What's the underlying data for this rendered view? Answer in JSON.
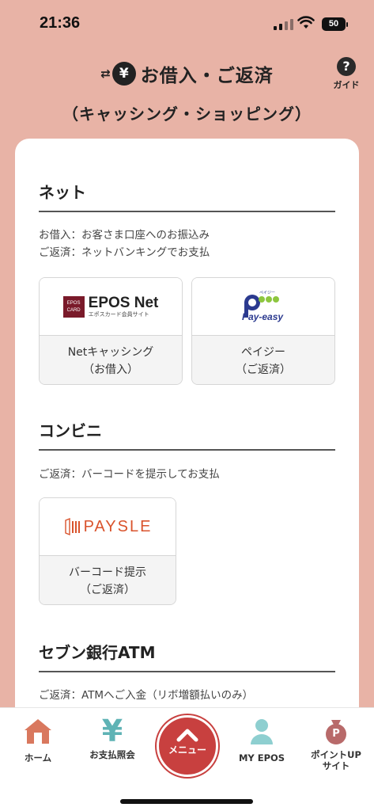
{
  "status_bar": {
    "time": "21:36",
    "battery": "50"
  },
  "header": {
    "title": "お借入・ご返済",
    "subtitle": "（キャッシング・ショッピング）",
    "yen_symbol": "¥",
    "guide_label": "ガイド",
    "guide_icon": "?"
  },
  "sections": {
    "net": {
      "heading": "ネット",
      "desc_line1": "お借入：お客さま口座へのお振込み",
      "desc_line2": "ご返済：ネットバンキングでお支払",
      "tile1": {
        "logo_badge_top": "EPOS",
        "logo_badge_bottom": "CARD",
        "logo_main": "EPOS Net",
        "logo_sub": "エポスカード会員サイト",
        "label_line1": "Netキャッシング",
        "label_line2": "（お借入）"
      },
      "tile2": {
        "logo_small": "ペイジー",
        "logo_main": "Pay-easy",
        "label_line1": "ペイジー",
        "label_line2": "（ご返済）"
      }
    },
    "convenience": {
      "heading": "コンビニ",
      "desc_line1": "ご返済：バーコードを提示してお支払",
      "tile1": {
        "logo_main": "PAYSLE",
        "label_line1": "バーコード提示",
        "label_line2": "（ご返済）"
      }
    },
    "seven": {
      "heading": "セブン銀行ATM",
      "desc_line1": "ご返済：ATMへご入金（リボ増額払いのみ）"
    }
  },
  "bottom_nav": {
    "home": "ホーム",
    "payment_inquiry": "お支払照会",
    "menu": "メニュー",
    "my_epos": "MY EPOS",
    "points_line1": "ポイントUP",
    "points_line2": "サイト",
    "yen_glyph": "¥",
    "points_glyph": "P"
  },
  "colors": {
    "background": "#E8B3A6",
    "accent": "#C8403F",
    "home_icon": "#D9785E",
    "nav_teal": "#5FB3B5",
    "points_icon": "#B86A6A"
  }
}
